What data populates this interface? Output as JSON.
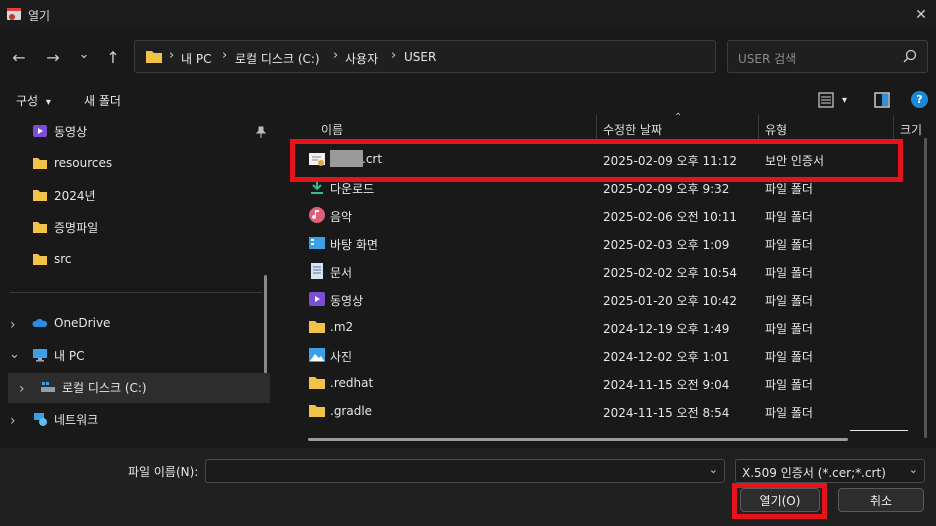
{
  "window": {
    "title": "열기",
    "close": "✕"
  },
  "nav": {
    "back": "←",
    "forward": "→",
    "recent": "⌄",
    "up": "↑",
    "breadcrumb": [
      "내 PC",
      "로컬 디스크 (C:)",
      "사용자",
      "USER"
    ],
    "separator": "›",
    "search_placeholder": "USER 검색"
  },
  "commands": {
    "organize": "구성",
    "organize_arrow": "▾",
    "new_folder": "새 폴더",
    "view_arrow": "▾",
    "help": "?"
  },
  "sidebar": {
    "quick": [
      {
        "label": "동영상",
        "icon": "video-icon",
        "pinned": true
      },
      {
        "label": "resources",
        "icon": "folder-icon"
      },
      {
        "label": "2024년",
        "icon": "folder-icon"
      },
      {
        "label": "증명파일",
        "icon": "folder-icon"
      },
      {
        "label": "src",
        "icon": "folder-icon"
      }
    ],
    "tree": [
      {
        "label": "OneDrive",
        "icon": "cloud-icon",
        "chevron": "›"
      },
      {
        "label": "내 PC",
        "icon": "pc-icon",
        "chevron": "⌄"
      },
      {
        "label": "로컬 디스크 (C:)",
        "icon": "drive-icon",
        "chevron": "›",
        "selected": true
      },
      {
        "label": "네트워크",
        "icon": "network-icon",
        "chevron": "›"
      }
    ]
  },
  "columns": {
    "name": "이름",
    "modified": "수정한 날짜",
    "type": "유형",
    "size": "크기",
    "sort_indicator": "⌃"
  },
  "files": [
    {
      "name": ".crt",
      "date": "2025-02-09 오후 11:12",
      "type": "보안 인증서",
      "icon": "certificate-icon",
      "redacted": true
    },
    {
      "name": "다운로드",
      "date": "2025-02-09 오후 9:32",
      "type": "파일 폴더",
      "icon": "download-icon"
    },
    {
      "name": "음악",
      "date": "2025-02-06 오전 10:11",
      "type": "파일 폴더",
      "icon": "music-icon"
    },
    {
      "name": "바탕 화면",
      "date": "2025-02-03 오후 1:09",
      "type": "파일 폴더",
      "icon": "desktop-icon"
    },
    {
      "name": "문서",
      "date": "2025-02-02 오후 10:54",
      "type": "파일 폴더",
      "icon": "document-icon"
    },
    {
      "name": "동영상",
      "date": "2025-01-20 오후 10:42",
      "type": "파일 폴더",
      "icon": "video-icon"
    },
    {
      "name": ".m2",
      "date": "2024-12-19 오후 1:49",
      "type": "파일 폴더",
      "icon": "folder-icon"
    },
    {
      "name": "사진",
      "date": "2024-12-02 오후 1:01",
      "type": "파일 폴더",
      "icon": "pictures-icon"
    },
    {
      "name": ".redhat",
      "date": "2024-11-15 오전 9:04",
      "type": "파일 폴더",
      "icon": "folder-icon"
    },
    {
      "name": ".gradle",
      "date": "2024-11-15 오전 8:54",
      "type": "파일 폴더",
      "icon": "folder-icon"
    }
  ],
  "footer": {
    "filename_label": "파일 이름(N):",
    "filename_value": "",
    "dropdown_arrow": "⌄",
    "filter": "X.509 인증서 (*.cer;*.crt)",
    "open": "열기(O)",
    "cancel": "취소"
  },
  "colors": {
    "highlight": "#e5141b",
    "folder": "#f0c24a",
    "accent": "#1a8ad8"
  }
}
